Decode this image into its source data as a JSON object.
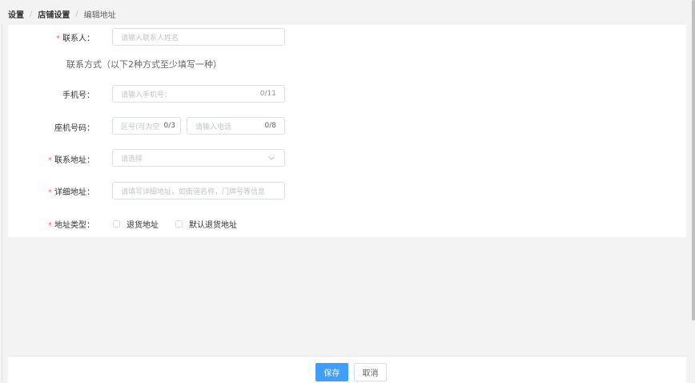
{
  "breadcrumb": {
    "level1": "设置",
    "level2": "店铺设置",
    "current": "编辑地址",
    "separator": "/"
  },
  "form": {
    "contact": {
      "label": "联系人：",
      "required": "*",
      "placeholder": "请输入联系人姓名"
    },
    "contact_method_title": "联系方式（以下2种方式至少填写一种）",
    "mobile": {
      "label": "手机号：",
      "placeholder": "请输入手机号：",
      "count": "0/11"
    },
    "landline": {
      "label": "座机号码：",
      "area_placeholder": "区号(可为空",
      "area_count": "0/3",
      "phone_placeholder": "请输入电话",
      "phone_count": "0/8"
    },
    "address": {
      "label": "联系地址：",
      "required": "*",
      "placeholder": "请选择",
      "icon": "chevron-down-icon"
    },
    "detail": {
      "label": "详细地址：",
      "required": "*",
      "placeholder": "请填写详细地址，如街道名称，门牌号等信息"
    },
    "address_type": {
      "label": "地址类型：",
      "required": "*",
      "options": [
        "退货地址",
        "默认退货地址"
      ]
    }
  },
  "footer": {
    "save_label": "保存",
    "cancel_label": "取消"
  },
  "colors": {
    "primary": "#409eff",
    "required": "#f56c6c",
    "border": "#dcdfe6",
    "background": "#f3f3f3"
  }
}
